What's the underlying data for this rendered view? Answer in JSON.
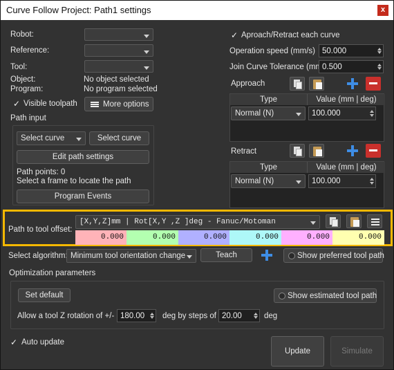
{
  "window": {
    "title": "Curve Follow Project: Path1 settings",
    "close_glyph": "x"
  },
  "left": {
    "robot_label": "Robot:",
    "reference_label": "Reference:",
    "tool_label": "Tool:",
    "object_label": "Object:",
    "object_value": "No object selected",
    "program_label": "Program:",
    "program_value": "No program selected",
    "visible_toolpath_label": "Visible toolpath",
    "visible_toolpath_checked": true,
    "more_options_label": "More options",
    "path_input_label": "Path input",
    "select_curve_combo": "Select curve",
    "select_curve_button": "Select curve",
    "edit_path_settings": "Edit path settings",
    "path_points": "Path points: 0",
    "select_frame_hint": "Select a frame to locate the path",
    "program_events": "Program Events"
  },
  "right": {
    "approach_retract_label": "Aproach/Retract each curve",
    "approach_retract_checked": true,
    "operation_speed_label": "Operation speed (mm/s)",
    "operation_speed_value": "50.000",
    "join_tolerance_label": "Join Curve Tolerance (mm)",
    "join_tolerance_value": "0.500",
    "approach": {
      "title": "Approach",
      "col_type": "Type",
      "col_value": "Value (mm | deg)",
      "row_type": "Normal (N)",
      "row_value": "100.000"
    },
    "retract": {
      "title": "Retract",
      "col_type": "Type",
      "col_value": "Value (mm | deg)",
      "row_type": "Normal (N)",
      "row_value": "100.000"
    }
  },
  "tool_offset": {
    "label": "Path to tool offset:",
    "format": "[X,Y,Z]mm | Rot[X,Y ,Z  ]deg - Fanuc/Motoman",
    "values": [
      "0.000",
      "0.000",
      "0.000",
      "0.000",
      "0.000",
      "0.000"
    ],
    "cell_colors": [
      "#ffb3b8",
      "#b3ffb0",
      "#b0b0ff",
      "#aef8f8",
      "#ffb0ff",
      "#ffffb0"
    ],
    "highlight_color": "#f5b800"
  },
  "algorithm": {
    "label": "Select algorithm:",
    "value": "Minimum tool orientation change",
    "teach": "Teach",
    "show_preferred": "Show preferred tool path"
  },
  "optimization": {
    "title": "Optimization parameters",
    "set_default": "Set default",
    "show_estimated": "Show estimated tool path",
    "allow_label": "Allow a tool Z rotation of +/-",
    "rotation_value": "180.00",
    "steps_label": "deg by steps of",
    "steps_value": "20.00",
    "deg_label": "deg"
  },
  "footer": {
    "auto_update_label": "Auto update",
    "auto_update_checked": true,
    "update": "Update",
    "simulate": "Simulate"
  },
  "icons": {
    "check": "✓",
    "accent": "#3e8de5",
    "danger": "#c9302c"
  }
}
